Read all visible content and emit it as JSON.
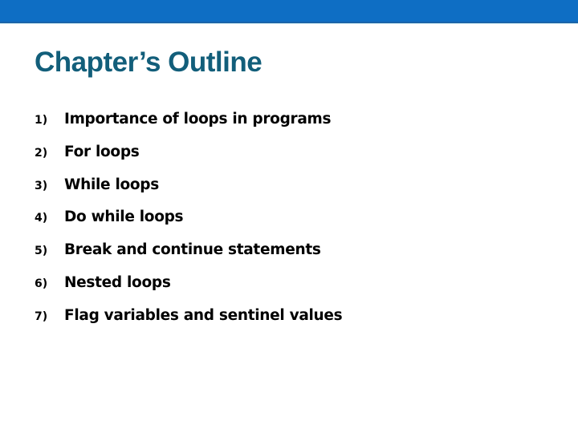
{
  "slide": {
    "colors": {
      "top_bar": "#0e6ec4",
      "title": "#125e7a",
      "body_text": "#000000"
    },
    "title": "Chapter’s Outline",
    "outline": [
      {
        "number": "1)",
        "text": "Importance of loops in programs"
      },
      {
        "number": "2)",
        "text": "For loops"
      },
      {
        "number": "3)",
        "text": "While loops"
      },
      {
        "number": "4)",
        "text": "Do while loops"
      },
      {
        "number": "5)",
        "text": "Break and continue statements"
      },
      {
        "number": "6)",
        "text": "Nested loops"
      },
      {
        "number": "7)",
        "text": "Flag variables and sentinel values"
      }
    ]
  }
}
